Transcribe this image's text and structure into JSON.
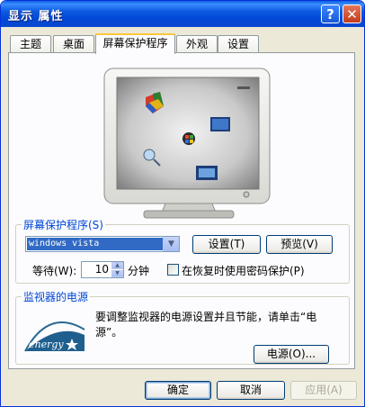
{
  "window": {
    "title": "显示 属性",
    "help_symbol": "?",
    "close_symbol": "✕"
  },
  "tabs": [
    {
      "label": "主题"
    },
    {
      "label": "桌面"
    },
    {
      "label": "屏幕保护程序",
      "active": true
    },
    {
      "label": "外观"
    },
    {
      "label": "设置"
    }
  ],
  "screensaver": {
    "group_label": "屏幕保护程序(S)",
    "selected": "windows vista",
    "settings_button": "设置(T)",
    "preview_button": "预览(V)",
    "wait_label": "等待(W):",
    "wait_value": "10",
    "wait_unit": "分钟",
    "password_checkbox_label": "在恢复时使用密码保护(P)",
    "password_checked": false
  },
  "power": {
    "group_label": "监视器的电源",
    "description": "要调整监视器的电源设置并且节能，请单击“电源”。",
    "power_button": "电源(O)...",
    "logo_text": "energy"
  },
  "footer": {
    "ok": "确定",
    "cancel": "取消",
    "apply": "应用(A)"
  }
}
